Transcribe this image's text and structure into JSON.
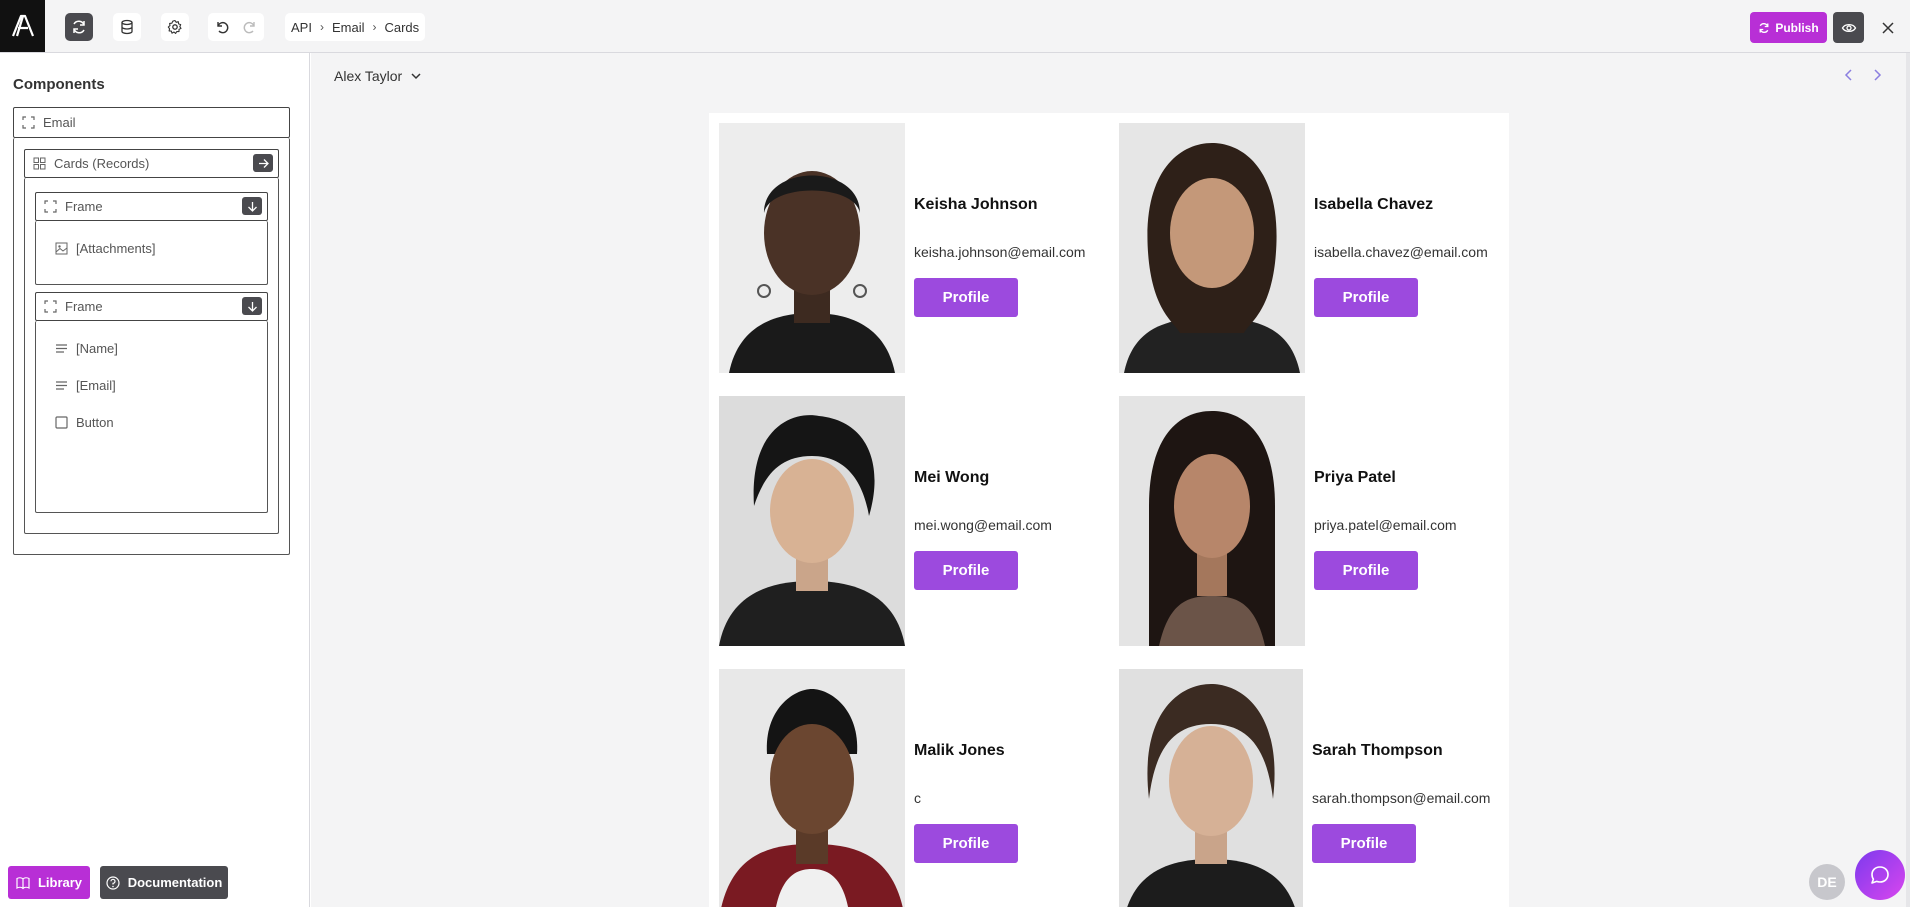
{
  "topbar": {
    "breadcrumb": [
      "API",
      "Email",
      "Cards"
    ],
    "publish_label": "Publish"
  },
  "sidebar": {
    "title": "Components",
    "tree": {
      "email": "Email",
      "cards": "Cards (Records)",
      "frame1": "Frame",
      "attachments": "[Attachments]",
      "frame2": "Frame",
      "name": "[Name]",
      "email_field": "[Email]",
      "button": "Button"
    },
    "library_label": "Library",
    "documentation_label": "Documentation"
  },
  "canvas": {
    "user": "Alex Taylor"
  },
  "cards": [
    {
      "name": "Keisha Johnson",
      "email": "keisha.johnson@email.com",
      "button": "Profile"
    },
    {
      "name": "Isabella Chavez",
      "email": "isabella.chavez@email.com",
      "button": "Profile"
    },
    {
      "name": "Mei Wong",
      "email": "mei.wong@email.com",
      "button": "Profile"
    },
    {
      "name": "Priya Patel",
      "email": "priya.patel@email.com",
      "button": "Profile"
    },
    {
      "name": "Malik Jones",
      "email": "c",
      "button": "Profile"
    },
    {
      "name": "Sarah Thompson",
      "email": "sarah.thompson@email.com",
      "button": "Profile"
    }
  ],
  "footer": {
    "avatar_initials": "DE"
  },
  "colors": {
    "publish": "#b82fd6",
    "profile_button": "#9c4ade",
    "dark_button": "#4a4a4f"
  }
}
